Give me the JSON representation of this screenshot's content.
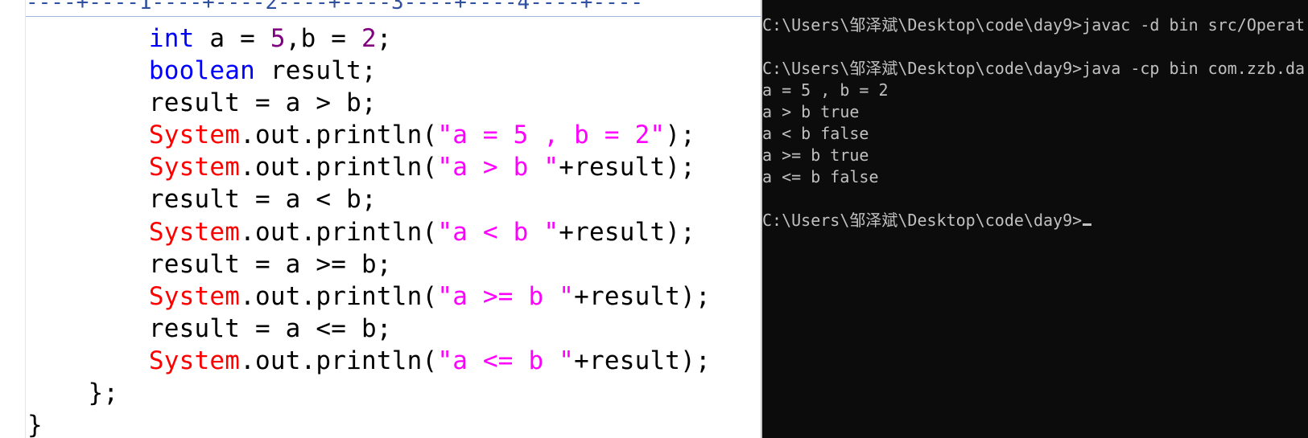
{
  "editor": {
    "ruler_marks": [
      "1",
      "2",
      "3",
      "4"
    ],
    "code_lines": [
      [
        {
          "t": "        "
        },
        {
          "t": "int",
          "c": "kw"
        },
        {
          "t": " a = "
        },
        {
          "t": "5",
          "c": "num"
        },
        {
          "t": ",b = "
        },
        {
          "t": "2",
          "c": "num"
        },
        {
          "t": ";"
        }
      ],
      [
        {
          "t": "        "
        },
        {
          "t": "boolean",
          "c": "kw"
        },
        {
          "t": " result;"
        }
      ],
      [
        {
          "t": "        result = a > b;"
        }
      ],
      [
        {
          "t": "        "
        },
        {
          "t": "System",
          "c": "cls"
        },
        {
          "t": ".out.println("
        },
        {
          "t": "\"a = 5 , b = 2\"",
          "c": "str"
        },
        {
          "t": ");"
        }
      ],
      [
        {
          "t": "        "
        },
        {
          "t": "System",
          "c": "cls"
        },
        {
          "t": ".out.println("
        },
        {
          "t": "\"a > b \"",
          "c": "str"
        },
        {
          "t": "+result);"
        }
      ],
      [
        {
          "t": "        result = a < b;"
        }
      ],
      [
        {
          "t": "        "
        },
        {
          "t": "System",
          "c": "cls"
        },
        {
          "t": ".out.println("
        },
        {
          "t": "\"a < b \"",
          "c": "str"
        },
        {
          "t": "+result);"
        }
      ],
      [
        {
          "t": "        result = a >= b;"
        }
      ],
      [
        {
          "t": "        "
        },
        {
          "t": "System",
          "c": "cls"
        },
        {
          "t": ".out.println("
        },
        {
          "t": "\"a >= b \"",
          "c": "str"
        },
        {
          "t": "+result);"
        }
      ],
      [
        {
          "t": "        result = a <= b;"
        }
      ],
      [
        {
          "t": "        "
        },
        {
          "t": "System",
          "c": "cls"
        },
        {
          "t": ".out.println("
        },
        {
          "t": "\"a <= b \"",
          "c": "str"
        },
        {
          "t": "+result);"
        }
      ],
      [
        {
          "t": "    };"
        }
      ],
      [
        {
          "t": "}"
        }
      ]
    ]
  },
  "console": {
    "lines": [
      "C:\\Users\\邹泽斌\\Desktop\\code\\day9>javac -d bin src/Operat",
      "",
      "C:\\Users\\邹泽斌\\Desktop\\code\\day9>java -cp bin com.zzb.da",
      "a = 5 , b = 2",
      "a > b true",
      "a < b false",
      "a >= b true",
      "a <= b false",
      "",
      "C:\\Users\\邹泽斌\\Desktop\\code\\day9>"
    ]
  },
  "colors": {
    "keyword": "#0000ff",
    "class": "#ff0000",
    "string": "#ff00ff",
    "number": "#800080",
    "console_bg": "#0c0c0c",
    "console_fg": "#c0c0c0"
  }
}
